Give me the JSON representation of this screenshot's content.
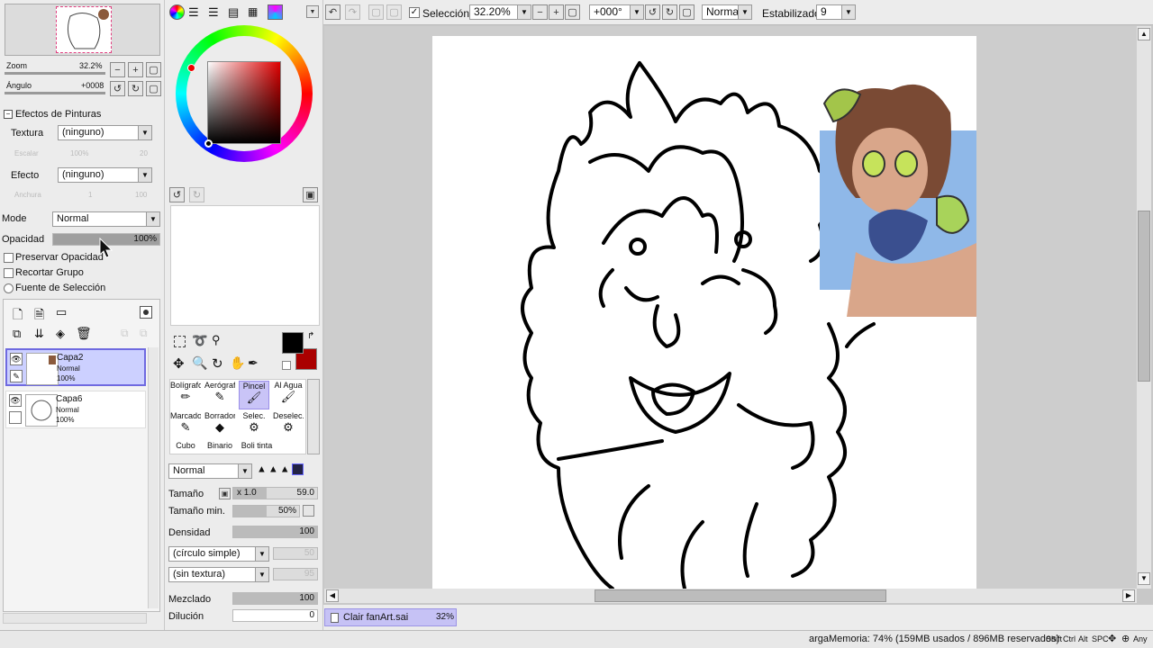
{
  "navigator": {
    "zoom_label": "Zoom",
    "zoom_value": "32.2%",
    "angle_label": "Ángulo",
    "angle_value": "+0008"
  },
  "paint_effects": {
    "title": "Efectos de Pinturas",
    "texture_label": "Textura",
    "texture_value": "(ninguno)",
    "scale_label": "Escalar",
    "scale_value": "100%",
    "scale_num": "20",
    "effect_label": "Efecto",
    "effect_value": "(ninguno)",
    "width_label": "Anchura",
    "width_value": "1",
    "width_num": "100"
  },
  "layer_props": {
    "mode_label": "Mode",
    "mode_value": "Normal",
    "opacity_label": "Opacidad",
    "opacity_value": "100%",
    "opacity_fraction": 1.0,
    "preserve_opacity": "Preservar Opacidad",
    "clip_group": "Recortar Grupo",
    "selection_source": "Fuente de Selección"
  },
  "layers": [
    {
      "name": "Capa2",
      "mode": "Normal",
      "opacity": "100%"
    },
    {
      "name": "Capa6",
      "mode": "Normal",
      "opacity": "100%"
    }
  ],
  "tools": [
    {
      "name": "Bolígrafo"
    },
    {
      "name": "Aerógraf"
    },
    {
      "name": "Pincel"
    },
    {
      "name": "Al Agua"
    },
    {
      "name": "Marcador"
    },
    {
      "name": "Borrador"
    },
    {
      "name": "Selec."
    },
    {
      "name": "Deselec."
    },
    {
      "name": "Cubo"
    },
    {
      "name": "Binario"
    },
    {
      "name": "Boli tinta"
    }
  ],
  "brush": {
    "blend_mode": "Normal",
    "size_label": "Tamaño",
    "size_mult": "x 1.0",
    "size_value": "59.0",
    "min_size_label": "Tamaño min.",
    "min_size_value": "50%",
    "density_label": "Densidad",
    "density_value": "100",
    "shape_value": "(círculo simple)",
    "shape_num": "50",
    "texture_value": "(sin textura)",
    "texture_num": "95",
    "mix_label": "Mezclado",
    "mix_value": "100",
    "dilution_label": "Dilución",
    "dilution_value": "0"
  },
  "toolbar": {
    "selection_label": "Selección",
    "zoom_value": "32.20%",
    "angle_value": "+000°",
    "blend_mode": "Normal",
    "stabilizer_label": "Estabilizador",
    "stabilizer_value": "9"
  },
  "document_tab": {
    "name": "Clair fanArt.sai",
    "zoom": "32%"
  },
  "status_bar": {
    "memory": "argaMemoria: 74% (159MB usados / 896MB reservados)",
    "keys": [
      "Shift",
      "Ctrl",
      "Alt",
      "SPC"
    ],
    "any_label": "Any"
  },
  "colors": {
    "primary": "#000000",
    "secondary": "#aa0000",
    "accent": "#6f6ae0"
  }
}
